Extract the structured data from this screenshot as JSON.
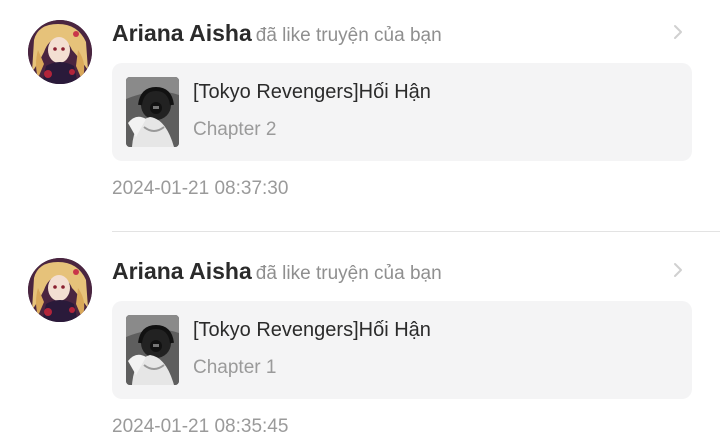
{
  "notifications": [
    {
      "user_name": "Ariana Aisha",
      "action": "đã like truyện của bạn",
      "avatar_icon": "anime-girl-avatar",
      "chevron_icon": "chevron-right-icon",
      "story": {
        "title": "[Tokyo Revengers]Hối Hận",
        "chapter": "Chapter 2",
        "cover_icon": "manga-cover-image"
      },
      "timestamp": "2024-01-21 08:37:30"
    },
    {
      "user_name": "Ariana Aisha",
      "action": "đã like truyện của bạn",
      "avatar_icon": "anime-girl-avatar",
      "chevron_icon": "chevron-right-icon",
      "story": {
        "title": "[Tokyo Revengers]Hối Hận",
        "chapter": "Chapter 1",
        "cover_icon": "manga-cover-image"
      },
      "timestamp": "2024-01-21 08:35:45"
    }
  ],
  "colors": {
    "name_text": "#2b2b2b",
    "secondary_text": "#9a9a9a",
    "card_background": "#f4f4f5",
    "divider": "#e3e3e3"
  }
}
